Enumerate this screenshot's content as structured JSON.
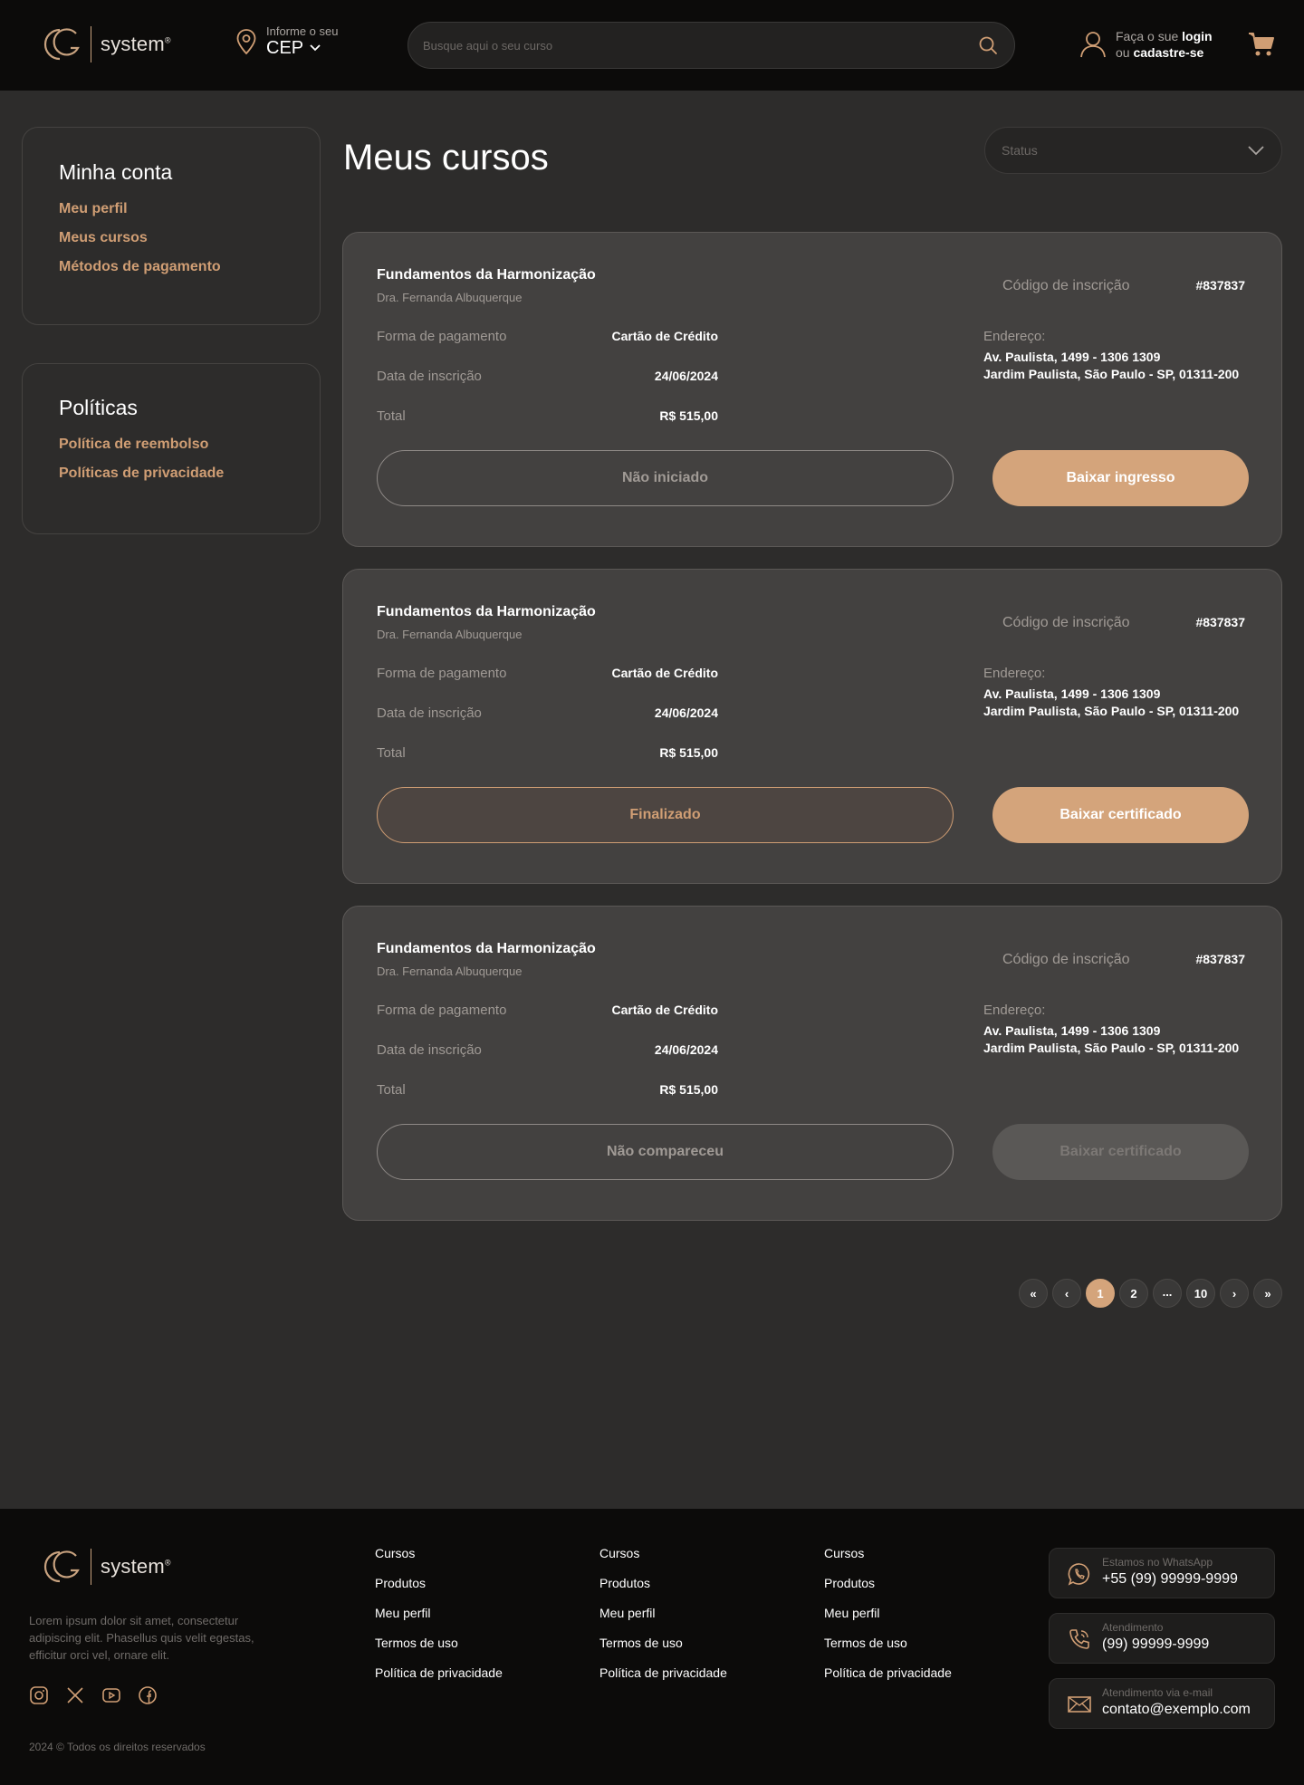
{
  "brand": {
    "name": "system",
    "reg": "®"
  },
  "header": {
    "cep_small": "Informe o seu",
    "cep_big": "CEP",
    "search_placeholder": "Busque aqui o seu curso",
    "login_prefix": "Faça o sue",
    "login_link": "login",
    "register_prefix": "ou",
    "register_link": "cadastre-se"
  },
  "sidebar": {
    "account_title": "Minha conta",
    "account_items": [
      "Meu perfil",
      "Meus cursos",
      "Métodos de pagamento"
    ],
    "policies_title": "Políticas",
    "policies_items": [
      "Política de reembolso",
      "Políticas de privacidade"
    ]
  },
  "main": {
    "title": "Meus cursos",
    "status_placeholder": "Status",
    "courses": [
      {
        "title": "Fundamentos da Harmonização",
        "author": "Dra. Fernanda Albuquerque",
        "payment_label": "Forma de pagamento",
        "payment_value": "Cartão de Crédito",
        "date_label": "Data de inscrição",
        "date_value": "24/06/2024",
        "total_label": "Total",
        "total_value": "R$ 515,00",
        "code_label": "Código de inscrição",
        "code_value": "#837837",
        "address_label": "Endereço:",
        "address_line1": "Av. Paulista, 1499 - 1306 1309",
        "address_line2": "Jardim Paulista, São Paulo - SP, 01311-200",
        "status": "Não iniciado",
        "action": "Baixar ingresso"
      },
      {
        "title": "Fundamentos da Harmonização",
        "author": "Dra. Fernanda Albuquerque",
        "payment_label": "Forma de pagamento",
        "payment_value": "Cartão de Crédito",
        "date_label": "Data de inscrição",
        "date_value": "24/06/2024",
        "total_label": "Total",
        "total_value": "R$ 515,00",
        "code_label": "Código de inscrição",
        "code_value": "#837837",
        "address_label": "Endereço:",
        "address_line1": "Av. Paulista, 1499 - 1306 1309",
        "address_line2": "Jardim Paulista, São Paulo - SP, 01311-200",
        "status": "Finalizado",
        "action": "Baixar certificado"
      },
      {
        "title": "Fundamentos da Harmonização",
        "author": "Dra. Fernanda Albuquerque",
        "payment_label": "Forma de pagamento",
        "payment_value": "Cartão de Crédito",
        "date_label": "Data de inscrição",
        "date_value": "24/06/2024",
        "total_label": "Total",
        "total_value": "R$ 515,00",
        "code_label": "Código de inscrição",
        "code_value": "#837837",
        "address_label": "Endereço:",
        "address_line1": "Av. Paulista, 1499 - 1306 1309",
        "address_line2": "Jardim Paulista, São Paulo - SP, 01311-200",
        "status": "Não compareceu",
        "action": "Baixar certificado"
      }
    ]
  },
  "pagination": {
    "first": "«",
    "prev": "‹",
    "pages": [
      "1",
      "2",
      "...",
      "10"
    ],
    "next": "›",
    "last": "»",
    "current": "1"
  },
  "footer": {
    "about": "Lorem ipsum dolor sit amet, consectetur adipiscing elit. Phasellus quis velit egestas, efficitur orci vel, ornare elit.",
    "copyright": "2024 © Todos os direitos reservados",
    "columns": [
      [
        "Cursos",
        "Produtos",
        "Meu perfil",
        "Termos de uso",
        "Política de privacidade"
      ],
      [
        "Cursos",
        "Produtos",
        "Meu perfil",
        "Termos de uso",
        "Política de privacidade"
      ],
      [
        "Cursos",
        "Produtos",
        "Meu perfil",
        "Termos de uso",
        "Política de privacidade"
      ]
    ],
    "contacts": [
      {
        "label": "Estamos no WhatsApp",
        "value": "+55 (99) 99999-9999",
        "icon": "whatsapp-icon"
      },
      {
        "label": "Atendimento",
        "value": "(99) 99999-9999",
        "icon": "phone-icon"
      },
      {
        "label": "Atendimento via e-mail",
        "value": "contato@exemplo.com",
        "icon": "mail-icon"
      }
    ],
    "socials": [
      "instagram-icon",
      "x-icon",
      "youtube-icon",
      "facebook-icon"
    ]
  },
  "colors": {
    "accent": "#d4a47b",
    "link": "#d09e74",
    "header_bg": "#0c0b0a",
    "page_bg": "#2d2c2b",
    "card_bg": "#434140"
  }
}
